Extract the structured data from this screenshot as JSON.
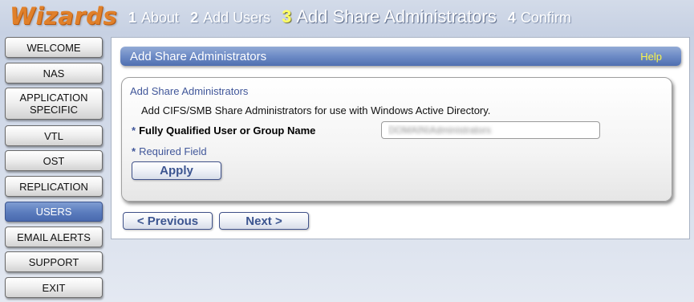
{
  "header": {
    "brand": "Wizards",
    "steps": [
      {
        "num": "1",
        "label": "About"
      },
      {
        "num": "2",
        "label": "Add Users"
      },
      {
        "num": "3",
        "label": "Add Share Administrators"
      },
      {
        "num": "4",
        "label": "Confirm"
      }
    ]
  },
  "sidebar": {
    "items": [
      {
        "label": "WELCOME"
      },
      {
        "label": "NAS"
      },
      {
        "label": "APPLICATION SPECIFIC"
      },
      {
        "label": "VTL"
      },
      {
        "label": "OST"
      },
      {
        "label": "REPLICATION"
      },
      {
        "label": "USERS"
      },
      {
        "label": "EMAIL ALERTS"
      },
      {
        "label": "SUPPORT"
      },
      {
        "label": "EXIT"
      }
    ]
  },
  "main": {
    "title": "Add Share Administrators",
    "help": "Help",
    "panel": {
      "title": "Add Share Administrators",
      "description": "Add CIFS/SMB Share Administrators for use with Windows Active Directory.",
      "field": {
        "required_mark": "*",
        "label": "Fully Qualified User or Group Name",
        "value": "DOMAIN\\Administrators"
      },
      "required_note_mark": "*",
      "required_note": "Required Field",
      "apply_label": "Apply"
    },
    "nav": {
      "previous_label": "< Previous",
      "next_label": "Next >"
    }
  },
  "colors": {
    "brand": "#e0802a",
    "active_step_number": "#ffff66",
    "title_bar": "#6d8bc6",
    "help_link": "#fcf64a",
    "selected_nav": "#5a7bbd",
    "label_blue": "#41579a"
  }
}
